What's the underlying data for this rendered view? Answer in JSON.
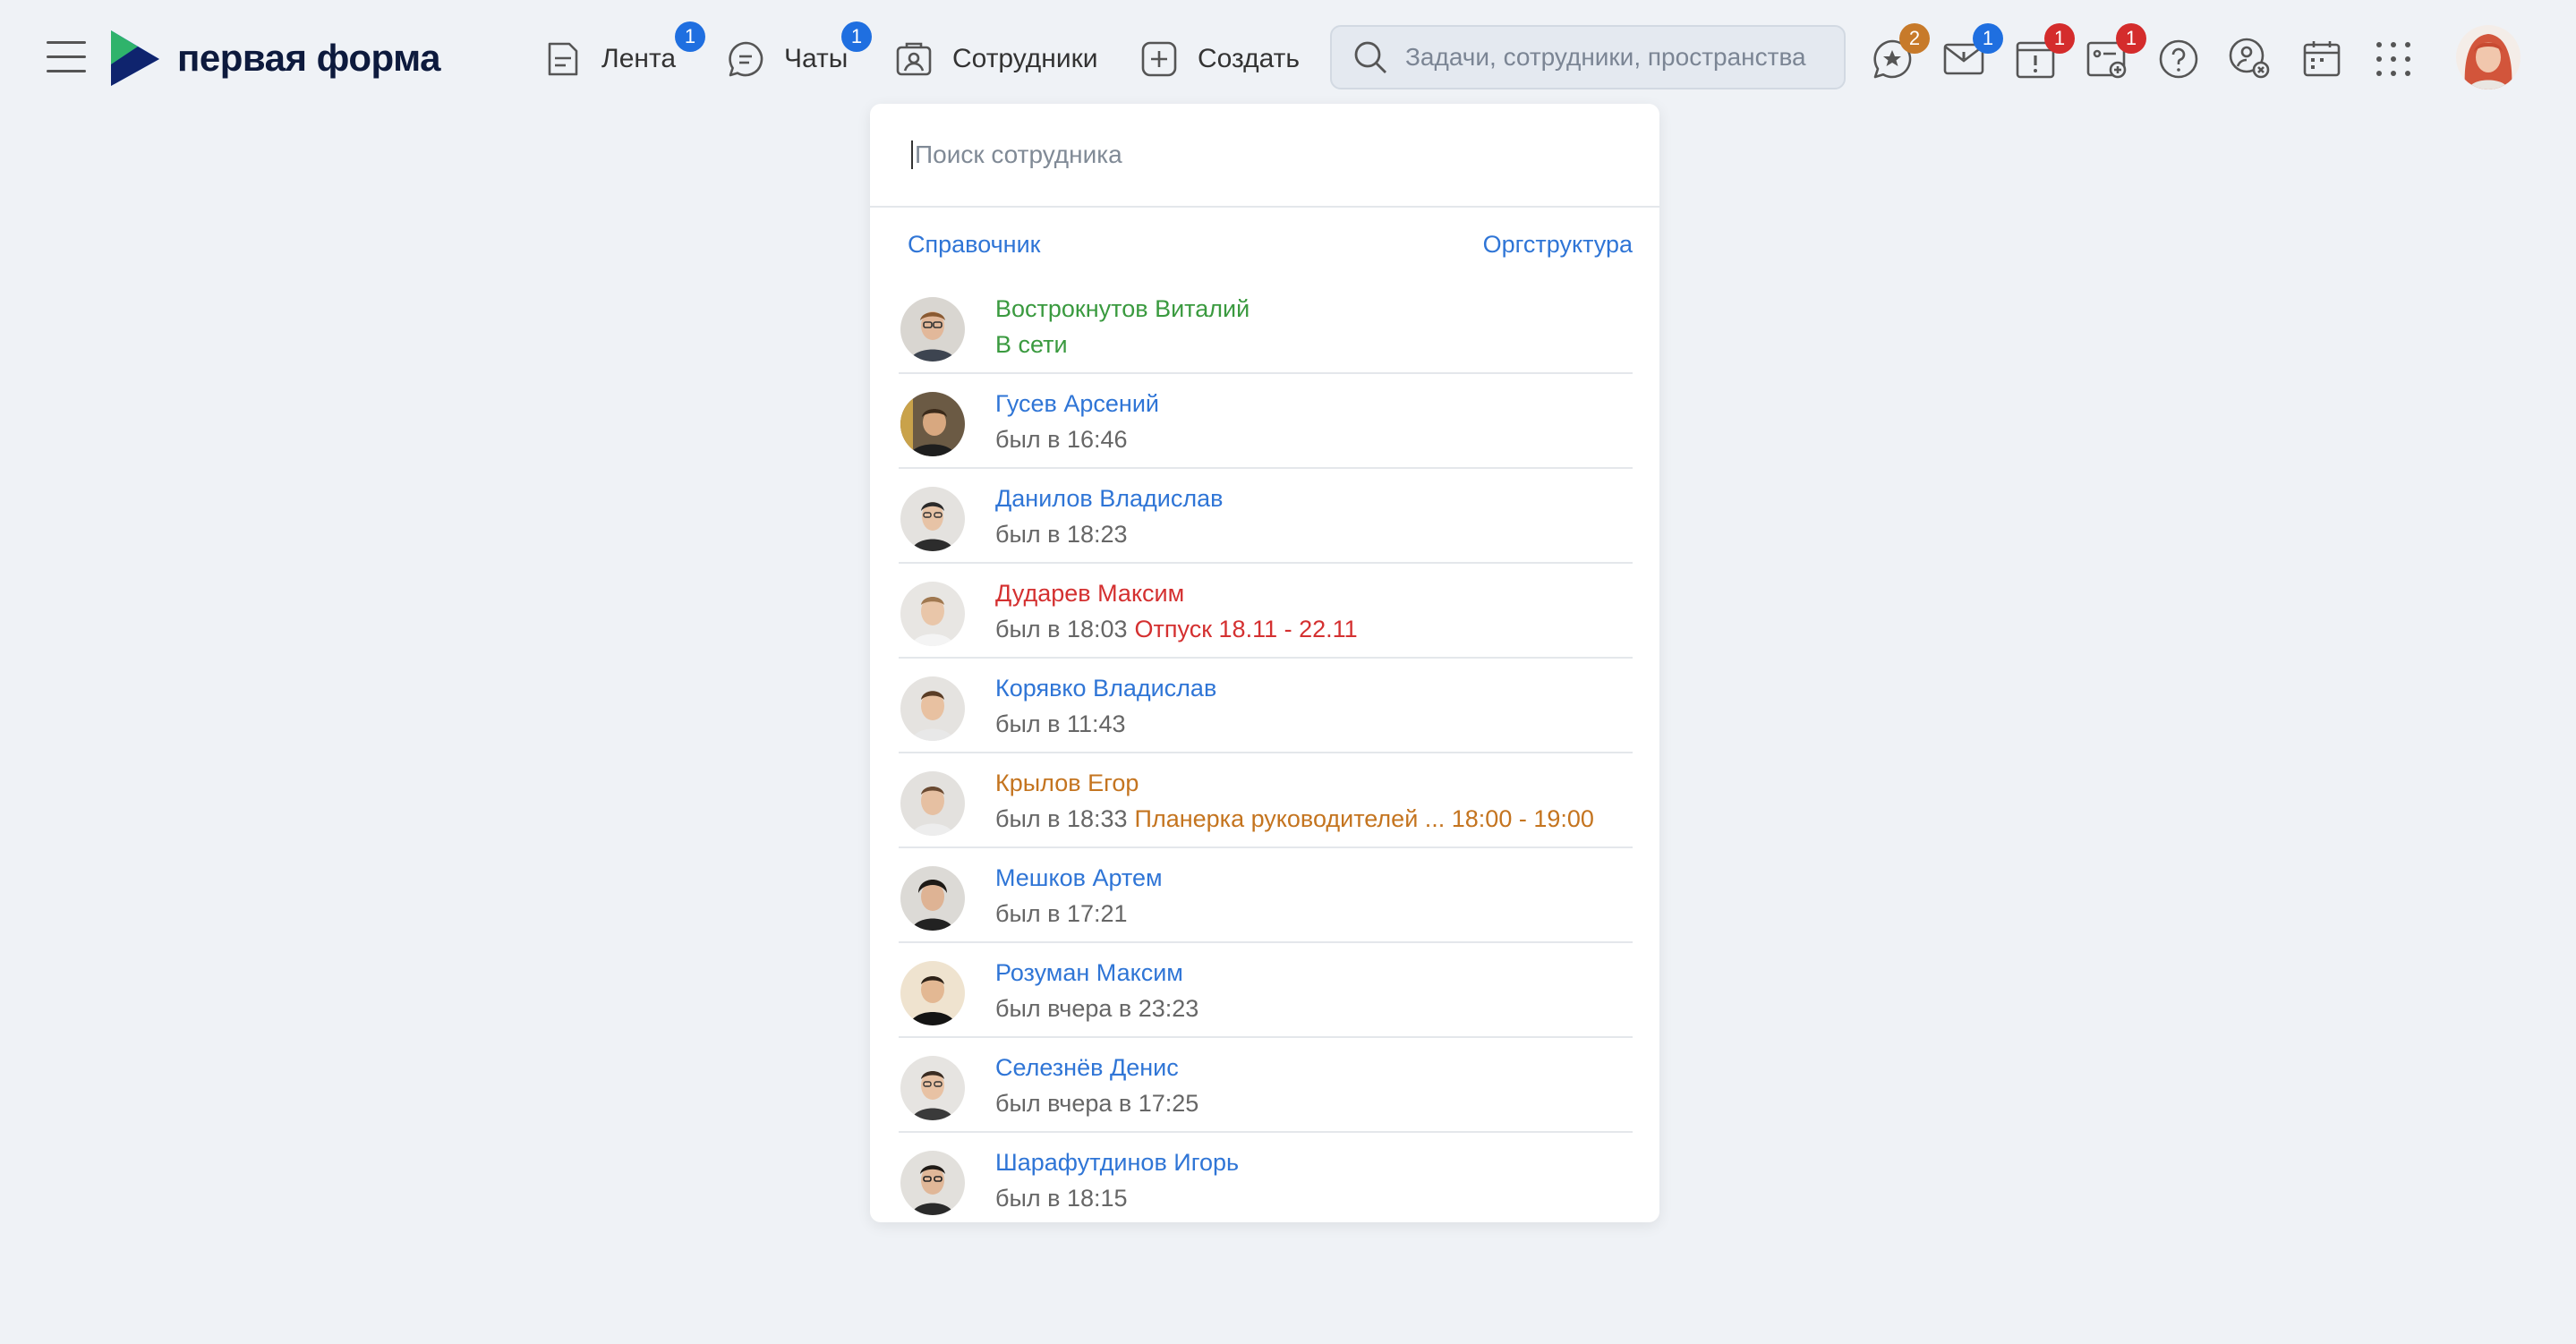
{
  "app": {
    "logo_text": "первая форма"
  },
  "colors": {
    "brand_blue": "#2f75d6",
    "online_green": "#3a9a3f",
    "vacation_red": "#d43030",
    "meeting_orange": "#c4741f",
    "badge_blue": "#1f6fe0",
    "badge_orange": "#c77a2a",
    "badge_red": "#d42c2c"
  },
  "nav": [
    {
      "label": "Лента",
      "icon": "feed-icon",
      "badge": "1"
    },
    {
      "label": "Чаты",
      "icon": "chat-icon",
      "badge": "1"
    },
    {
      "label": "Сотрудники",
      "icon": "employees-icon"
    },
    {
      "label": "Создать",
      "icon": "plus-square-icon"
    }
  ],
  "search": {
    "placeholder": "Задачи, сотрудники, пространства"
  },
  "toolbar_icons": [
    {
      "name": "favorites-icon",
      "badge": "2"
    },
    {
      "name": "messages-icon",
      "badge": "1"
    },
    {
      "name": "alerts-icon",
      "badge": "1"
    },
    {
      "name": "approvals-icon",
      "badge": "1"
    },
    {
      "name": "help-icon"
    },
    {
      "name": "user-settings-icon"
    },
    {
      "name": "calendar-icon"
    },
    {
      "name": "apps-grid-icon"
    }
  ],
  "dropdown": {
    "search_placeholder": "Поиск сотрудника",
    "directory_link": "Справочник",
    "orgchart_link": "Оргструктура",
    "employees": [
      {
        "name": "Вострокнутов Виталий",
        "status": "В сети",
        "type": "online"
      },
      {
        "name": "Гусев Арсений",
        "status": "был в 16:46",
        "type": "normal"
      },
      {
        "name": "Данилов Владислав",
        "status": "был в 18:23",
        "type": "normal"
      },
      {
        "name": "Дударев Максим",
        "status": "был в 18:03",
        "extra": "Отпуск 18.11 - 22.11",
        "type": "vacation"
      },
      {
        "name": "Корявко Владислав",
        "status": "был в 11:43",
        "type": "normal"
      },
      {
        "name": "Крылов Егор",
        "status": "был в 18:33",
        "extra": "Планерка руководителей ... 18:00 - 19:00",
        "type": "meeting"
      },
      {
        "name": "Мешков Артем",
        "status": "был в 17:21",
        "type": "normal"
      },
      {
        "name": "Розуман Максим",
        "status": "был вчера в 23:23",
        "type": "normal"
      },
      {
        "name": "Селезнёв Денис",
        "status": "был вчера в 17:25",
        "type": "normal"
      },
      {
        "name": "Шарафутдинов Игорь",
        "status": "был в 18:15",
        "type": "normal"
      }
    ]
  }
}
